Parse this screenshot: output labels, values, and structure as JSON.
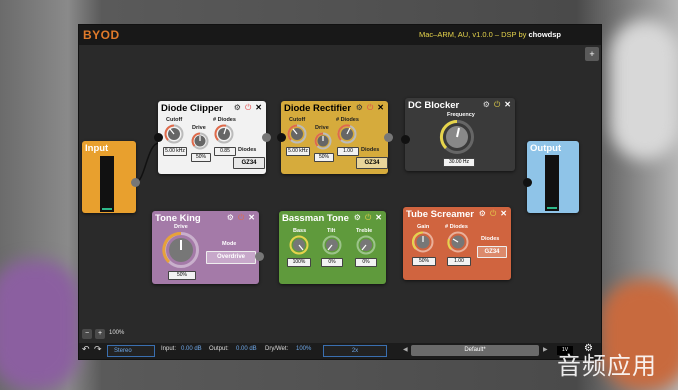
{
  "app": {
    "brand": "BYOD",
    "version_prefix": "Mac–ARM, AU, v1.0.0 – DSP by ",
    "version_author": "chowdsp",
    "add_button": "+"
  },
  "modules": {
    "input": {
      "title": "Input"
    },
    "output": {
      "title": "Output"
    },
    "diode_clipper": {
      "title": "Diode Clipper",
      "cutoff_label": "Cutoff",
      "cutoff_value": "5.00 kHz",
      "drive_label": "Drive",
      "drive_value": "50%",
      "diodes_label": "# Diodes",
      "diodes_value": "0.85",
      "type_label": "Diodes",
      "type_value": "GZ34"
    },
    "diode_rectifier": {
      "title": "Diode Rectifier",
      "cutoff_label": "Cutoff",
      "cutoff_value": "5.00 kHz",
      "drive_label": "Drive",
      "drive_value": "50%",
      "diodes_label": "# Diodes",
      "diodes_value": "1.00",
      "type_label": "Diodes",
      "type_value": "GZ34"
    },
    "dc_blocker": {
      "title": "DC Blocker",
      "freq_label": "Frequency",
      "freq_value": "30.00 Hz"
    },
    "tone_king": {
      "title": "Tone King",
      "drive_label": "Drive",
      "drive_value": "50%",
      "mode_label": "Mode",
      "mode_value": "Overdrive"
    },
    "bassman": {
      "title": "Bassman Tone",
      "bass_label": "Bass",
      "bass_value": "100%",
      "tilt_label": "Tilt",
      "tilt_value": "0%",
      "treble_label": "Treble",
      "treble_value": "0%"
    },
    "tube_screamer": {
      "title": "Tube Screamer",
      "gain_label": "Gain",
      "gain_value": "50%",
      "diodes_label": "# Diodes",
      "diodes_value": "1.00",
      "type_label": "Diodes",
      "type_value": "GZ34"
    }
  },
  "bottom": {
    "zoom_out": "−",
    "zoom_in": "+",
    "zoom": "100%",
    "undo": "↶",
    "redo": "↷",
    "channel": "Stereo",
    "input_label": "Input:",
    "input_value": "0.00 dB",
    "output_label": "Output:",
    "output_value": "0.00 dB",
    "drywet_label": "Dry/Wet:",
    "drywet_value": "100%",
    "oversample": "2x",
    "preset": "Default*",
    "prev": "◀",
    "next": "▶",
    "ab": "1V"
  },
  "watermark": "音频应用"
}
